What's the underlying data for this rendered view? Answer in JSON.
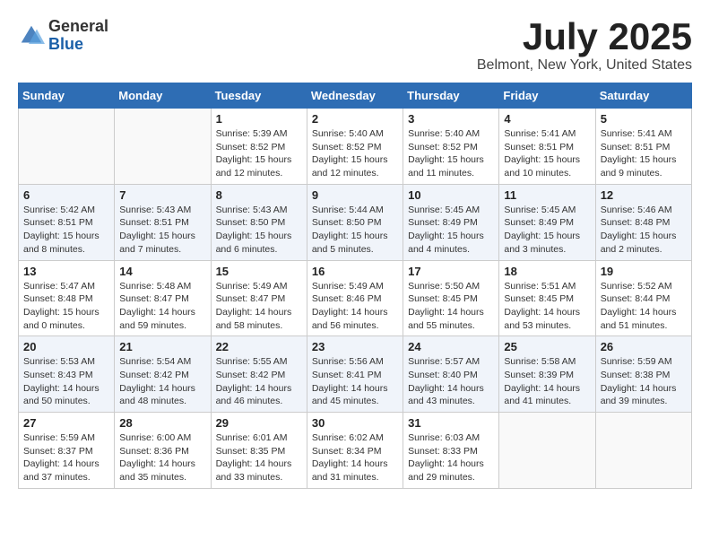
{
  "header": {
    "logo_general": "General",
    "logo_blue": "Blue",
    "month": "July 2025",
    "location": "Belmont, New York, United States"
  },
  "weekdays": [
    "Sunday",
    "Monday",
    "Tuesday",
    "Wednesday",
    "Thursday",
    "Friday",
    "Saturday"
  ],
  "weeks": [
    [
      {
        "day": "",
        "info": ""
      },
      {
        "day": "",
        "info": ""
      },
      {
        "day": "1",
        "info": "Sunrise: 5:39 AM\nSunset: 8:52 PM\nDaylight: 15 hours and 12 minutes."
      },
      {
        "day": "2",
        "info": "Sunrise: 5:40 AM\nSunset: 8:52 PM\nDaylight: 15 hours and 12 minutes."
      },
      {
        "day": "3",
        "info": "Sunrise: 5:40 AM\nSunset: 8:52 PM\nDaylight: 15 hours and 11 minutes."
      },
      {
        "day": "4",
        "info": "Sunrise: 5:41 AM\nSunset: 8:51 PM\nDaylight: 15 hours and 10 minutes."
      },
      {
        "day": "5",
        "info": "Sunrise: 5:41 AM\nSunset: 8:51 PM\nDaylight: 15 hours and 9 minutes."
      }
    ],
    [
      {
        "day": "6",
        "info": "Sunrise: 5:42 AM\nSunset: 8:51 PM\nDaylight: 15 hours and 8 minutes."
      },
      {
        "day": "7",
        "info": "Sunrise: 5:43 AM\nSunset: 8:51 PM\nDaylight: 15 hours and 7 minutes."
      },
      {
        "day": "8",
        "info": "Sunrise: 5:43 AM\nSunset: 8:50 PM\nDaylight: 15 hours and 6 minutes."
      },
      {
        "day": "9",
        "info": "Sunrise: 5:44 AM\nSunset: 8:50 PM\nDaylight: 15 hours and 5 minutes."
      },
      {
        "day": "10",
        "info": "Sunrise: 5:45 AM\nSunset: 8:49 PM\nDaylight: 15 hours and 4 minutes."
      },
      {
        "day": "11",
        "info": "Sunrise: 5:45 AM\nSunset: 8:49 PM\nDaylight: 15 hours and 3 minutes."
      },
      {
        "day": "12",
        "info": "Sunrise: 5:46 AM\nSunset: 8:48 PM\nDaylight: 15 hours and 2 minutes."
      }
    ],
    [
      {
        "day": "13",
        "info": "Sunrise: 5:47 AM\nSunset: 8:48 PM\nDaylight: 15 hours and 0 minutes."
      },
      {
        "day": "14",
        "info": "Sunrise: 5:48 AM\nSunset: 8:47 PM\nDaylight: 14 hours and 59 minutes."
      },
      {
        "day": "15",
        "info": "Sunrise: 5:49 AM\nSunset: 8:47 PM\nDaylight: 14 hours and 58 minutes."
      },
      {
        "day": "16",
        "info": "Sunrise: 5:49 AM\nSunset: 8:46 PM\nDaylight: 14 hours and 56 minutes."
      },
      {
        "day": "17",
        "info": "Sunrise: 5:50 AM\nSunset: 8:45 PM\nDaylight: 14 hours and 55 minutes."
      },
      {
        "day": "18",
        "info": "Sunrise: 5:51 AM\nSunset: 8:45 PM\nDaylight: 14 hours and 53 minutes."
      },
      {
        "day": "19",
        "info": "Sunrise: 5:52 AM\nSunset: 8:44 PM\nDaylight: 14 hours and 51 minutes."
      }
    ],
    [
      {
        "day": "20",
        "info": "Sunrise: 5:53 AM\nSunset: 8:43 PM\nDaylight: 14 hours and 50 minutes."
      },
      {
        "day": "21",
        "info": "Sunrise: 5:54 AM\nSunset: 8:42 PM\nDaylight: 14 hours and 48 minutes."
      },
      {
        "day": "22",
        "info": "Sunrise: 5:55 AM\nSunset: 8:42 PM\nDaylight: 14 hours and 46 minutes."
      },
      {
        "day": "23",
        "info": "Sunrise: 5:56 AM\nSunset: 8:41 PM\nDaylight: 14 hours and 45 minutes."
      },
      {
        "day": "24",
        "info": "Sunrise: 5:57 AM\nSunset: 8:40 PM\nDaylight: 14 hours and 43 minutes."
      },
      {
        "day": "25",
        "info": "Sunrise: 5:58 AM\nSunset: 8:39 PM\nDaylight: 14 hours and 41 minutes."
      },
      {
        "day": "26",
        "info": "Sunrise: 5:59 AM\nSunset: 8:38 PM\nDaylight: 14 hours and 39 minutes."
      }
    ],
    [
      {
        "day": "27",
        "info": "Sunrise: 5:59 AM\nSunset: 8:37 PM\nDaylight: 14 hours and 37 minutes."
      },
      {
        "day": "28",
        "info": "Sunrise: 6:00 AM\nSunset: 8:36 PM\nDaylight: 14 hours and 35 minutes."
      },
      {
        "day": "29",
        "info": "Sunrise: 6:01 AM\nSunset: 8:35 PM\nDaylight: 14 hours and 33 minutes."
      },
      {
        "day": "30",
        "info": "Sunrise: 6:02 AM\nSunset: 8:34 PM\nDaylight: 14 hours and 31 minutes."
      },
      {
        "day": "31",
        "info": "Sunrise: 6:03 AM\nSunset: 8:33 PM\nDaylight: 14 hours and 29 minutes."
      },
      {
        "day": "",
        "info": ""
      },
      {
        "day": "",
        "info": ""
      }
    ]
  ]
}
